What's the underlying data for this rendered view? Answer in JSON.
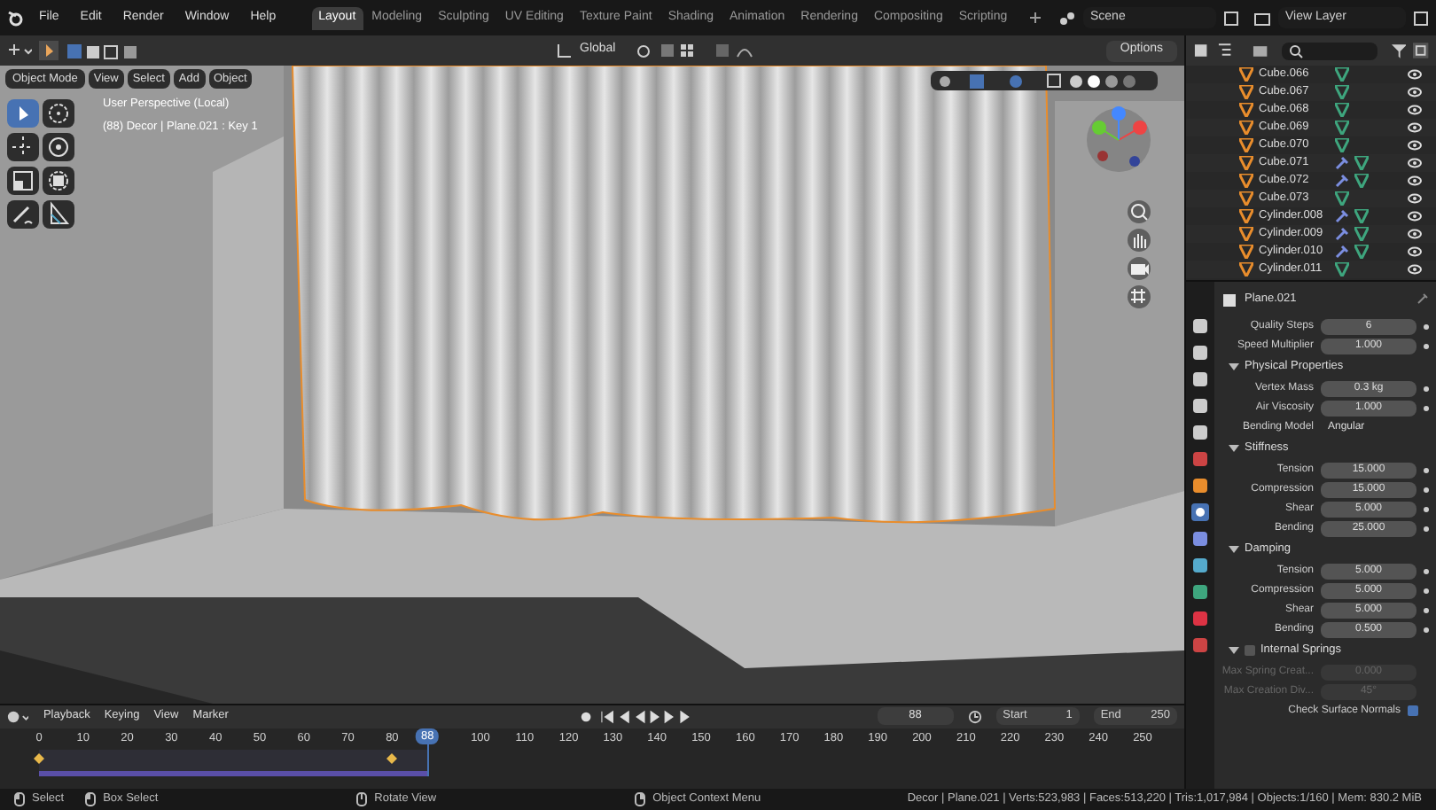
{
  "menu_bar": {
    "menus": [
      "File",
      "Edit",
      "Render",
      "Window",
      "Help"
    ],
    "workspaces": [
      {
        "label": "Layout",
        "selected": true
      },
      {
        "label": "Modeling",
        "selected": false
      },
      {
        "label": "Sculpting",
        "selected": false
      },
      {
        "label": "UV Editing",
        "selected": false
      },
      {
        "label": "Texture Paint",
        "selected": false
      },
      {
        "label": "Shading",
        "selected": false
      },
      {
        "label": "Animation",
        "selected": false
      },
      {
        "label": "Rendering",
        "selected": false
      },
      {
        "label": "Compositing",
        "selected": false
      },
      {
        "label": "Scripting",
        "selected": false
      }
    ],
    "scene": "Scene",
    "view_layer": "View Layer"
  },
  "viewport": {
    "transform_orientation": "Global",
    "options": "Options",
    "mode": "Object Mode",
    "menus": [
      "View",
      "Select",
      "Add",
      "Object"
    ],
    "info": [
      "User Perspective (Local)",
      "(88) Decor | Plane.021 : Key 1"
    ],
    "tools": [
      {
        "kind": "select",
        "selected": true
      },
      {
        "kind": "cursor",
        "selected": false
      },
      {
        "kind": "move",
        "selected": false
      },
      {
        "kind": "rotate",
        "selected": false
      },
      {
        "kind": "scale",
        "selected": false
      },
      {
        "kind": "transform",
        "selected": false
      },
      {
        "kind": "annotate",
        "selected": false
      },
      {
        "kind": "measure",
        "selected": false
      }
    ]
  },
  "outliner": {
    "items": [
      {
        "name": "Cube.066",
        "modifier": false
      },
      {
        "name": "Cube.067",
        "modifier": false
      },
      {
        "name": "Cube.068",
        "modifier": false
      },
      {
        "name": "Cube.069",
        "modifier": false
      },
      {
        "name": "Cube.070",
        "modifier": false
      },
      {
        "name": "Cube.071",
        "modifier": true
      },
      {
        "name": "Cube.072",
        "modifier": true
      },
      {
        "name": "Cube.073",
        "modifier": false
      },
      {
        "name": "Cylinder.008",
        "modifier": true
      },
      {
        "name": "Cylinder.009",
        "modifier": true
      },
      {
        "name": "Cylinder.010",
        "modifier": true
      },
      {
        "name": "Cylinder.011",
        "modifier": false
      }
    ]
  },
  "properties": {
    "object_name": "Plane.021",
    "rows": [
      {
        "kind": "field",
        "label": "Quality Steps",
        "value": "6",
        "disabled": false
      },
      {
        "kind": "field",
        "label": "Speed Multiplier",
        "value": "1.000",
        "disabled": false
      },
      {
        "kind": "section",
        "label": "Physical Properties",
        "expanded": true
      },
      {
        "kind": "field",
        "label": "Vertex Mass",
        "value": "0.3 kg",
        "disabled": false
      },
      {
        "kind": "field",
        "label": "Air Viscosity",
        "value": "1.000",
        "disabled": false
      },
      {
        "kind": "dropdown",
        "label": "Bending Model",
        "value": "Angular"
      },
      {
        "kind": "section",
        "label": "Stiffness",
        "expanded": true
      },
      {
        "kind": "field",
        "label": "Tension",
        "value": "15.000",
        "disabled": false
      },
      {
        "kind": "field",
        "label": "Compression",
        "value": "15.000",
        "disabled": false
      },
      {
        "kind": "field",
        "label": "Shear",
        "value": "5.000",
        "disabled": false
      },
      {
        "kind": "field",
        "label": "Bending",
        "value": "25.000",
        "disabled": false
      },
      {
        "kind": "section",
        "label": "Damping",
        "expanded": true
      },
      {
        "kind": "field",
        "label": "Tension",
        "value": "5.000",
        "disabled": false
      },
      {
        "kind": "field",
        "label": "Compression",
        "value": "5.000",
        "disabled": false
      },
      {
        "kind": "field",
        "label": "Shear",
        "value": "5.000",
        "disabled": false
      },
      {
        "kind": "field",
        "label": "Bending",
        "value": "0.500",
        "disabled": false
      },
      {
        "kind": "checksection",
        "label": "Internal Springs",
        "expanded": true,
        "checked": false
      },
      {
        "kind": "field",
        "label": "Max Spring Creat...",
        "value": "0.000",
        "disabled": true
      },
      {
        "kind": "field",
        "label": "Max Creation Div...",
        "value": "45°",
        "disabled": true
      },
      {
        "kind": "checkbox",
        "label": "Check Surface Normals",
        "checked": true
      }
    ]
  },
  "timeline": {
    "menus": [
      "Playback",
      "Keying",
      "View",
      "Marker"
    ],
    "current_frame": "88",
    "start_label": "Start",
    "start": "1",
    "end_label": "End",
    "end": "250",
    "ticks": [
      "0",
      "10",
      "20",
      "30",
      "40",
      "50",
      "60",
      "70",
      "80",
      "100",
      "110",
      "120",
      "130",
      "140",
      "150",
      "160",
      "170",
      "180",
      "190",
      "200",
      "210",
      "220",
      "230",
      "240",
      "250"
    ],
    "playhead": "88"
  },
  "status_bar": {
    "hints": [
      {
        "kind": "mouse-left",
        "label": "Select"
      },
      {
        "kind": "mouse-drag",
        "label": "Box Select"
      },
      {
        "kind": "mouse-middle",
        "label": "Rotate View"
      },
      {
        "kind": "mouse-right",
        "label": "Object Context Menu"
      }
    ],
    "stats": "Decor | Plane.021 | Verts:523,983 | Faces:513,220 | Tris:1,017,984 | Objects:1/160 | Mem: 830.2 MiB"
  }
}
